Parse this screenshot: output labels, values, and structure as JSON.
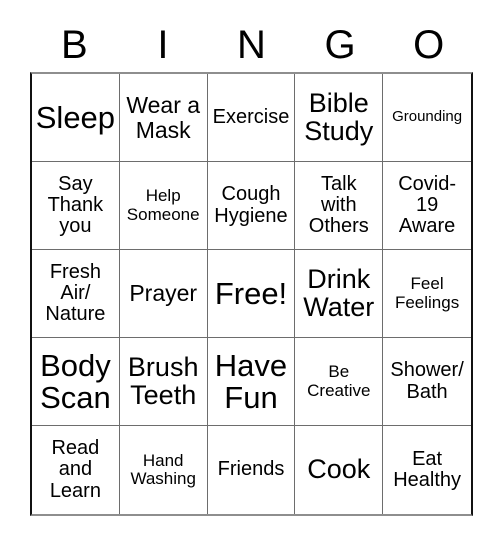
{
  "card": {
    "title": "BINGO",
    "header_letters": [
      "B",
      "I",
      "N",
      "G",
      "O"
    ],
    "columns": 5,
    "rows": 5,
    "free_space": "Free!",
    "free_space_position": "row 3, column 3",
    "colors": {
      "background": "#ffffff",
      "text": "#000000",
      "grid_line": "#6d6d6d",
      "outer_border_dark": "#111111",
      "outer_border_light": "#8e8e8e"
    },
    "cells": [
      {
        "text": "Sleep",
        "size": "sz-xl"
      },
      {
        "text": "Wear a\nMask",
        "size": "sz-md"
      },
      {
        "text": "Exercise",
        "size": "sz-sm"
      },
      {
        "text": "Bible\nStudy",
        "size": "sz-lg"
      },
      {
        "text": "Grounding",
        "size": "sz-xxs"
      },
      {
        "text": "Say\nThank\nyou",
        "size": "sz-sm"
      },
      {
        "text": "Help\nSomeone",
        "size": "sz-xs"
      },
      {
        "text": "Cough\nHygiene",
        "size": "sz-sm"
      },
      {
        "text": "Talk\nwith\nOthers",
        "size": "sz-sm"
      },
      {
        "text": "Covid-\n19\nAware",
        "size": "sz-sm"
      },
      {
        "text": "Fresh\nAir/\nNature",
        "size": "sz-sm"
      },
      {
        "text": "Prayer",
        "size": "sz-md"
      },
      {
        "text": "Free!",
        "size": "sz-xl"
      },
      {
        "text": "Drink\nWater",
        "size": "sz-lg"
      },
      {
        "text": "Feel\nFeelings",
        "size": "sz-xs"
      },
      {
        "text": "Body\nScan",
        "size": "sz-xl"
      },
      {
        "text": "Brush\nTeeth",
        "size": "sz-lg"
      },
      {
        "text": "Have\nFun",
        "size": "sz-xl"
      },
      {
        "text": "Be\nCreative",
        "size": "sz-xs"
      },
      {
        "text": "Shower/\nBath",
        "size": "sz-sm"
      },
      {
        "text": "Read\nand\nLearn",
        "size": "sz-sm"
      },
      {
        "text": "Hand\nWashing",
        "size": "sz-xs"
      },
      {
        "text": "Friends",
        "size": "sz-sm"
      },
      {
        "text": "Cook",
        "size": "sz-lg"
      },
      {
        "text": "Eat\nHealthy",
        "size": "sz-sm"
      }
    ]
  }
}
